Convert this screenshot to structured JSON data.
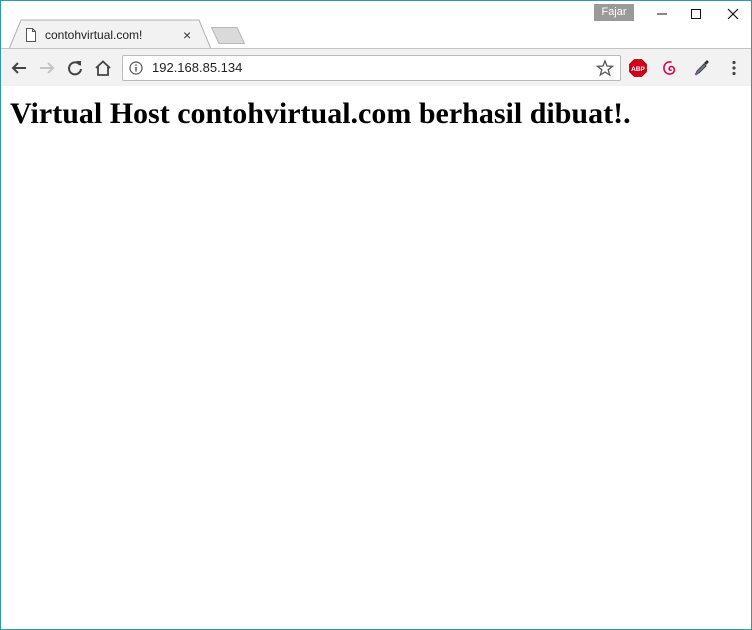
{
  "window": {
    "profile_name": "Fajar",
    "controls": [
      "minimize-icon",
      "maximize-icon",
      "close-icon"
    ]
  },
  "tab": {
    "title": "contohvirtual.com!",
    "close_label": "×",
    "icon": "page-icon"
  },
  "toolbar": {
    "url": "192.168.85.134",
    "buttons": [
      "back-icon",
      "forward-icon",
      "reload-icon",
      "home-icon"
    ],
    "extensions": [
      "abp-icon",
      "debian-swirl-icon",
      "eyedropper-icon",
      "menu-dots-icon"
    ],
    "abp_label": "ABP"
  },
  "page": {
    "heading": "Virtual Host contohvirtual.com berhasil dibuat!."
  },
  "colors": {
    "window_border": "#2b9ca6",
    "toolbar_bg": "#f2f2f2",
    "abp_red": "#d0021b",
    "debian_red": "#d70a53"
  }
}
